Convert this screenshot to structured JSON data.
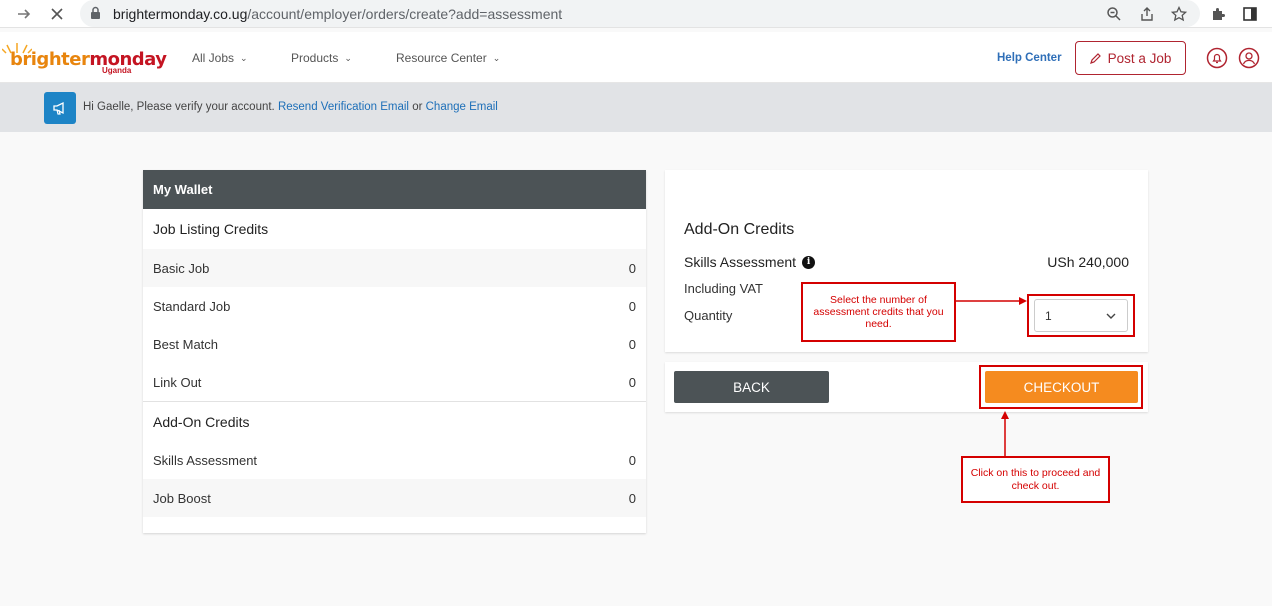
{
  "browser": {
    "url_host": "brightermonday.co.ug",
    "url_path": "/account/employer/orders/create?add=assessment"
  },
  "header": {
    "logo_brand_a": "brighter",
    "logo_brand_b": "monday",
    "logo_sub": "Uganda",
    "menu": [
      "All Jobs",
      "Products",
      "Resource Center"
    ],
    "help_label": "Help Center",
    "post_job_label": "Post a Job"
  },
  "banner": {
    "text": "Hi Gaelle, Please verify your account. ",
    "resend_link": "Resend Verification Email",
    "or_text": " or ",
    "change_link": "Change Email"
  },
  "wallet": {
    "title": "My Wallet",
    "job_section": "Job Listing Credits",
    "job_rows": [
      {
        "label": "Basic Job",
        "value": "0"
      },
      {
        "label": "Standard Job",
        "value": "0"
      },
      {
        "label": "Best Match",
        "value": "0"
      },
      {
        "label": "Link Out",
        "value": "0"
      }
    ],
    "addon_section": "Add-On Credits",
    "addon_rows": [
      {
        "label": "Skills Assessment",
        "value": "0"
      },
      {
        "label": "Job Boost",
        "value": "0"
      }
    ]
  },
  "addon": {
    "title": "Add-On Credits",
    "product": "Skills Assessment",
    "info_glyph": "i",
    "price": "USh 240,000",
    "vat_label": "Including VAT",
    "qty_label": "Quantity",
    "qty_value": "1"
  },
  "actions": {
    "back_label": "BACK",
    "checkout_label": "CHECKOUT"
  },
  "annotations": {
    "qty_note": "Select the number of assessment credits that you need.",
    "checkout_note": "Click on this to proceed and check out."
  },
  "colors": {
    "brand_orange": "#f58b1f",
    "brand_red": "#b02430",
    "dark_gray": "#4c5356",
    "link_blue": "#1d6fb8",
    "annotation_red": "#d40000"
  }
}
